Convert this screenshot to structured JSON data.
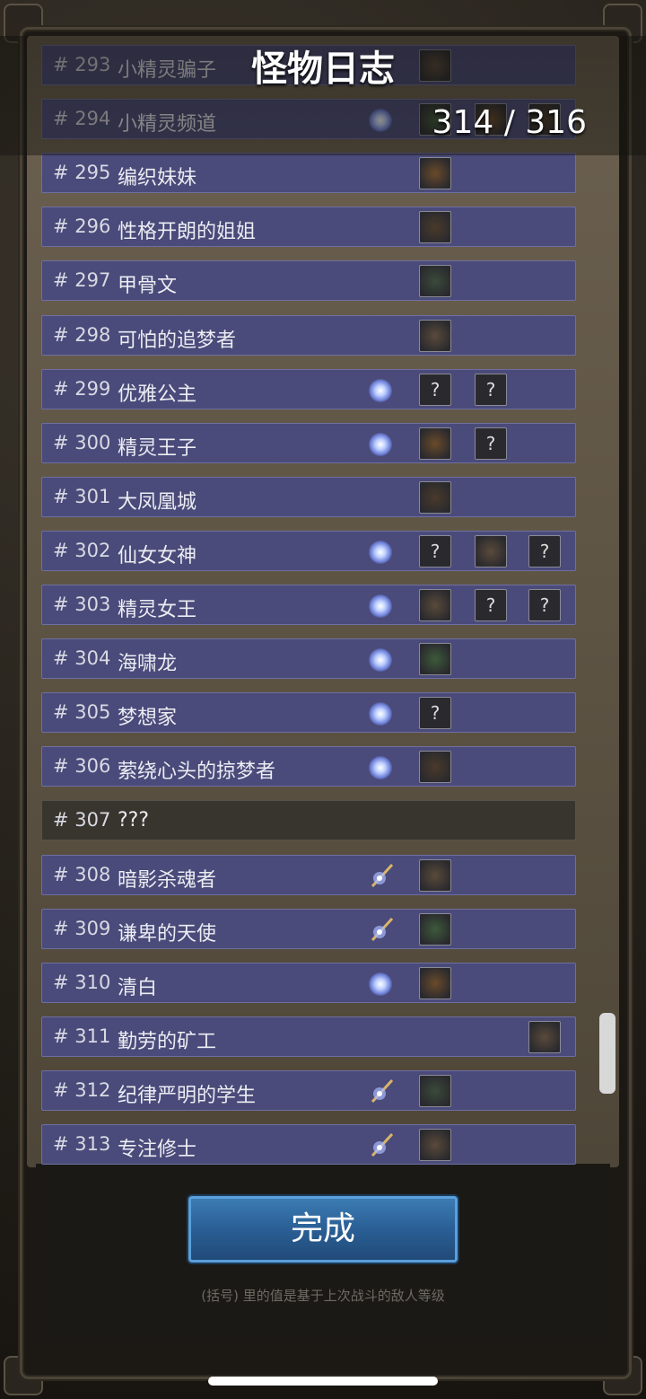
{
  "header": {
    "title": "怪物日志",
    "count": "314 / 316"
  },
  "rows": [
    {
      "num": "# 293",
      "name": "小精灵骗子",
      "atom": false,
      "wand": false,
      "slots": [
        "item",
        null,
        null
      ],
      "unknown": false
    },
    {
      "num": "# 294",
      "name": "小精灵频道",
      "atom": true,
      "wand": false,
      "slots": [
        "item",
        "item",
        "item"
      ],
      "unknown": false
    },
    {
      "num": "# 295",
      "name": "编织妹妹",
      "atom": false,
      "wand": false,
      "slots": [
        "item",
        null,
        null
      ],
      "unknown": false
    },
    {
      "num": "# 296",
      "name": "性格开朗的姐姐",
      "atom": false,
      "wand": false,
      "slots": [
        "item",
        null,
        null
      ],
      "unknown": false
    },
    {
      "num": "# 297",
      "name": "甲骨文",
      "atom": false,
      "wand": false,
      "slots": [
        "item",
        null,
        null
      ],
      "unknown": false
    },
    {
      "num": "# 298",
      "name": "可怕的追梦者",
      "atom": false,
      "wand": false,
      "slots": [
        "item",
        null,
        null
      ],
      "unknown": false
    },
    {
      "num": "# 299",
      "name": "优雅公主",
      "atom": true,
      "wand": false,
      "slots": [
        "?",
        "?",
        null
      ],
      "unknown": false
    },
    {
      "num": "# 300",
      "name": "精灵王子",
      "atom": true,
      "wand": false,
      "slots": [
        "item",
        "?",
        null
      ],
      "unknown": false
    },
    {
      "num": "# 301",
      "name": "大凤凰城",
      "atom": false,
      "wand": false,
      "slots": [
        "item",
        null,
        null
      ],
      "unknown": false
    },
    {
      "num": "# 302",
      "name": "仙女女神",
      "atom": true,
      "wand": false,
      "slots": [
        "?",
        "item",
        "?"
      ],
      "unknown": false
    },
    {
      "num": "# 303",
      "name": "精灵女王",
      "atom": true,
      "wand": false,
      "slots": [
        "item",
        "?",
        "?"
      ],
      "unknown": false
    },
    {
      "num": "# 304",
      "name": "海啸龙",
      "atom": true,
      "wand": false,
      "slots": [
        "item",
        null,
        null
      ],
      "unknown": false
    },
    {
      "num": "# 305",
      "name": "梦想家",
      "atom": true,
      "wand": false,
      "slots": [
        "?",
        null,
        null
      ],
      "unknown": false
    },
    {
      "num": "# 306",
      "name": "萦绕心头的掠梦者",
      "atom": true,
      "wand": false,
      "slots": [
        "item",
        null,
        null
      ],
      "unknown": false
    },
    {
      "num": "# 307",
      "name": "???",
      "atom": false,
      "wand": false,
      "slots": [
        null,
        null,
        null
      ],
      "unknown": true
    },
    {
      "num": "# 308",
      "name": "暗影杀魂者",
      "atom": false,
      "wand": true,
      "slots": [
        "item",
        null,
        null
      ],
      "unknown": false
    },
    {
      "num": "# 309",
      "name": "谦卑的天使",
      "atom": false,
      "wand": true,
      "slots": [
        "item",
        null,
        null
      ],
      "unknown": false
    },
    {
      "num": "# 310",
      "name": "清白",
      "atom": true,
      "wand": false,
      "slots": [
        "item",
        null,
        null
      ],
      "unknown": false
    },
    {
      "num": "# 311",
      "name": "勤劳的矿工",
      "atom": false,
      "wand": false,
      "slots": [
        null,
        null,
        "item"
      ],
      "unknown": false
    },
    {
      "num": "# 312",
      "name": "纪律严明的学生",
      "atom": false,
      "wand": true,
      "slots": [
        "item",
        null,
        null
      ],
      "unknown": false
    },
    {
      "num": "# 313",
      "name": "专注修士",
      "atom": false,
      "wand": true,
      "slots": [
        "item",
        null,
        null
      ],
      "unknown": false
    }
  ],
  "done_button": "完成",
  "footnote": "(括号) 里的值是基于上次战斗的敌人等级",
  "colors": {
    "row_bg": "#4a4b7a",
    "unknown_row_bg": "#38352e",
    "button": "#2a5f95"
  }
}
